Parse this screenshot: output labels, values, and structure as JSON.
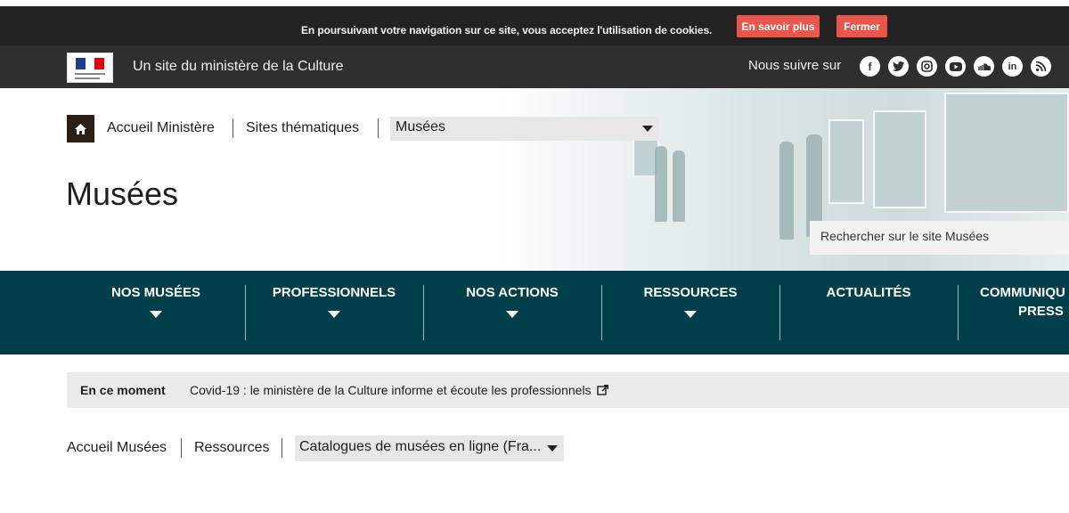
{
  "cookie": {
    "message": "En poursuivant votre navigation sur ce site, vous acceptez l'utilisation de cookies.",
    "more_label": "En savoir plus",
    "close_label": "Fermer",
    "button_color": "#e8564c"
  },
  "gov_bar": {
    "site_owner": "Un site du ministère de la Culture",
    "follow_label": "Nous suivre sur",
    "socials": [
      "facebook-icon",
      "twitter-icon",
      "instagram-icon",
      "youtube-icon",
      "soundcloud-icon",
      "linkedin-icon",
      "rss-icon"
    ]
  },
  "breadcrumb_top": {
    "items": [
      "Accueil Ministère",
      "Sites thématiques"
    ],
    "selected": "Musées"
  },
  "page": {
    "title": "Musées",
    "search_placeholder": "Rechercher sur le site Musées"
  },
  "nav": {
    "background": "#003f49",
    "items": [
      {
        "label": "NOS MUSÉES",
        "line2": ""
      },
      {
        "label": "PROFESSIONNELS",
        "line2": ""
      },
      {
        "label": "NOS ACTIONS",
        "line2": ""
      },
      {
        "label": "RESSOURCES",
        "line2": ""
      },
      {
        "label": "ACTUALITÉS",
        "line2": ""
      },
      {
        "label": "COMMUNIQU",
        "line2": "PRESS"
      }
    ]
  },
  "news": {
    "label": "En ce moment",
    "text": "Covid-19 : le ministère de la Culture informe et écoute les professionnels"
  },
  "breadcrumb_bottom": {
    "items": [
      "Accueil Musées",
      "Ressources"
    ],
    "selected": "Catalogues de musées en ligne (Fra..."
  }
}
